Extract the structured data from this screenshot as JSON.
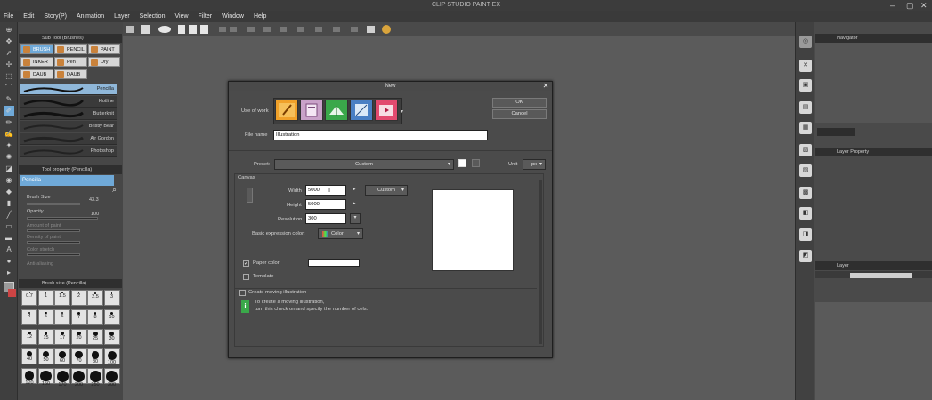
{
  "app": {
    "title": "CLIP STUDIO PAINT EX"
  },
  "menu": [
    "File",
    "Edit",
    "Story(P)",
    "Animation",
    "Layer",
    "Selection",
    "View",
    "Filter",
    "Window",
    "Help"
  ],
  "subtool": {
    "header": "Sub Tool (Brushes)",
    "tabs": [
      "BRUSH",
      "PENCIL",
      "PAINT",
      "INKER",
      "Pen",
      "Dry",
      "DAUB",
      "DAUB"
    ],
    "brushes": [
      "Pencilla",
      "Hotline",
      "Butterknit",
      "Bristly Bear",
      "Air Gordon",
      "Photoshop"
    ]
  },
  "toolprop": {
    "header": "Tool property (Pencilla)",
    "brush_name": "Pencilla",
    "brush_size_label": "Brush Size",
    "brush_size_value": "43.3",
    "opacity_label": "Opacity",
    "opacity_value": "100",
    "amount_label": "Amount of paint",
    "density_label": "Density of paint",
    "color_stretch_label": "Color stretch",
    "antialias_label": "Anti-aliasing"
  },
  "brushsize": {
    "header": "Brush size (Pencilla)",
    "sizes": [
      "0.7",
      "1",
      "1.5",
      "2",
      "2.5",
      "3",
      "4",
      "5",
      "6",
      "7",
      "8",
      "10",
      "12",
      "15",
      "17",
      "20",
      "25",
      "30",
      "40",
      "50",
      "60",
      "70",
      "80",
      "100",
      "120",
      "150",
      "170",
      "200",
      "250",
      "300"
    ]
  },
  "right": {
    "navigator": "Navigator",
    "layer_property": "Layer Property",
    "layer": "Layer"
  },
  "dialog": {
    "title": "New",
    "close": "✕",
    "use_of_work_label": "Use of work",
    "file_name_label": "File name",
    "file_name_value": "Illustration",
    "ok": "OK",
    "cancel": "Cancel",
    "preset_label": "Preset:",
    "preset_value": "Custom",
    "unit_label": "Unit",
    "unit_value": "px",
    "canvas_label": "Canvas",
    "width_label": "Width",
    "width_value": "5000",
    "height_label": "Height",
    "height_value": "5000",
    "resolution_label": "Resolution",
    "resolution_value": "300",
    "size_preset": "Custom",
    "expression_label": "Basic expression color:",
    "expression_value": "Color",
    "paper_color_label": "Paper color",
    "template_label": "Template",
    "moving_label": "Create moving illustration",
    "info_line1": "To create a moving illustration,",
    "info_line2": "turn this check on and specify the number of cels.",
    "info_icon": "i"
  },
  "colors": {
    "accent": "#6fa9d8",
    "dialog_bg": "#4b4b4b",
    "panel_bg": "#474747",
    "paper": "#ffffff"
  },
  "icons": [
    "quill-icon",
    "folder-icon",
    "book-icon",
    "comic-icon",
    "film-icon"
  ]
}
